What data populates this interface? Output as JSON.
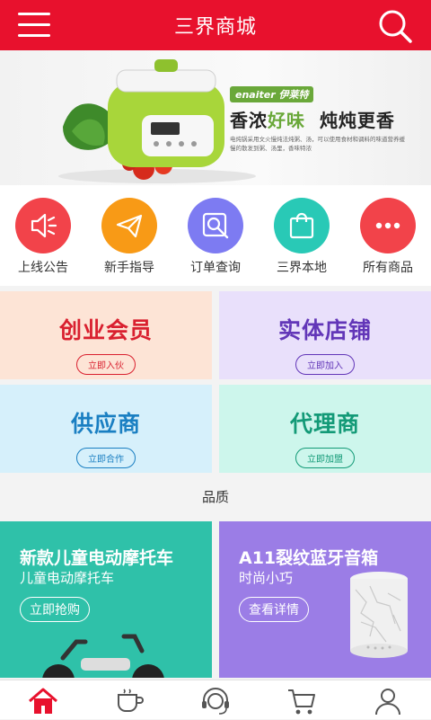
{
  "header": {
    "title": "三界商城",
    "menu_icon": "menu-icon",
    "search_icon": "search-icon"
  },
  "banner": {
    "brand": "enaiter 伊莱特",
    "slogan_pre": "香浓",
    "slogan_hl": "好味",
    "slogan_post": "炖炖更香",
    "desc": "电炖锅采用文火慢炖法炖粥、汤，可以使用食材和调料的味道营养缓慢的散发到粥、汤里，香味特浓",
    "accent": "#6aa83a"
  },
  "quick_links": [
    {
      "label": "上线公告",
      "icon": "speaker-icon",
      "color": "#f2434a"
    },
    {
      "label": "新手指导",
      "icon": "paper-plane-icon",
      "color": "#f89a16"
    },
    {
      "label": "订单查询",
      "icon": "order-search-icon",
      "color": "#7d7bf2"
    },
    {
      "label": "三界本地",
      "icon": "shopping-bag-icon",
      "color": "#29c9b6"
    },
    {
      "label": "所有商品",
      "icon": "more-dots-icon",
      "color": "#f2434a"
    }
  ],
  "cards": [
    {
      "title": "创业会员",
      "button": "立即入伙",
      "color": "#d9202f",
      "bg": "#fde4d6"
    },
    {
      "title": "实体店铺",
      "button": "立即加入",
      "color": "#6236b8",
      "bg": "#e9e0fb"
    },
    {
      "title": "供应商",
      "button": "立即合作",
      "color": "#1a7fc2",
      "bg": "#d6f0fb"
    },
    {
      "title": "代理商",
      "button": "立即加盟",
      "color": "#139a77",
      "bg": "#cdf6ec"
    }
  ],
  "section": {
    "title": "品质"
  },
  "promos": [
    {
      "title": "新款儿童电动摩托车",
      "subtitle": "儿童电动摩托车",
      "button": "立即抢购",
      "bg": "#2fc1a9"
    },
    {
      "title": "A11裂纹蓝牙音箱",
      "subtitle": "时尚小巧",
      "button": "查看详情",
      "bg": "#9b7de6"
    }
  ],
  "tabbar": [
    {
      "name": "home-tab",
      "icon": "home-icon",
      "color": "#e8112d"
    },
    {
      "name": "category-tab",
      "icon": "cup-icon",
      "color": "#555555"
    },
    {
      "name": "service-tab",
      "icon": "headset-icon",
      "color": "#555555"
    },
    {
      "name": "cart-tab",
      "icon": "cart-icon",
      "color": "#555555"
    },
    {
      "name": "profile-tab",
      "icon": "user-icon",
      "color": "#555555"
    }
  ]
}
